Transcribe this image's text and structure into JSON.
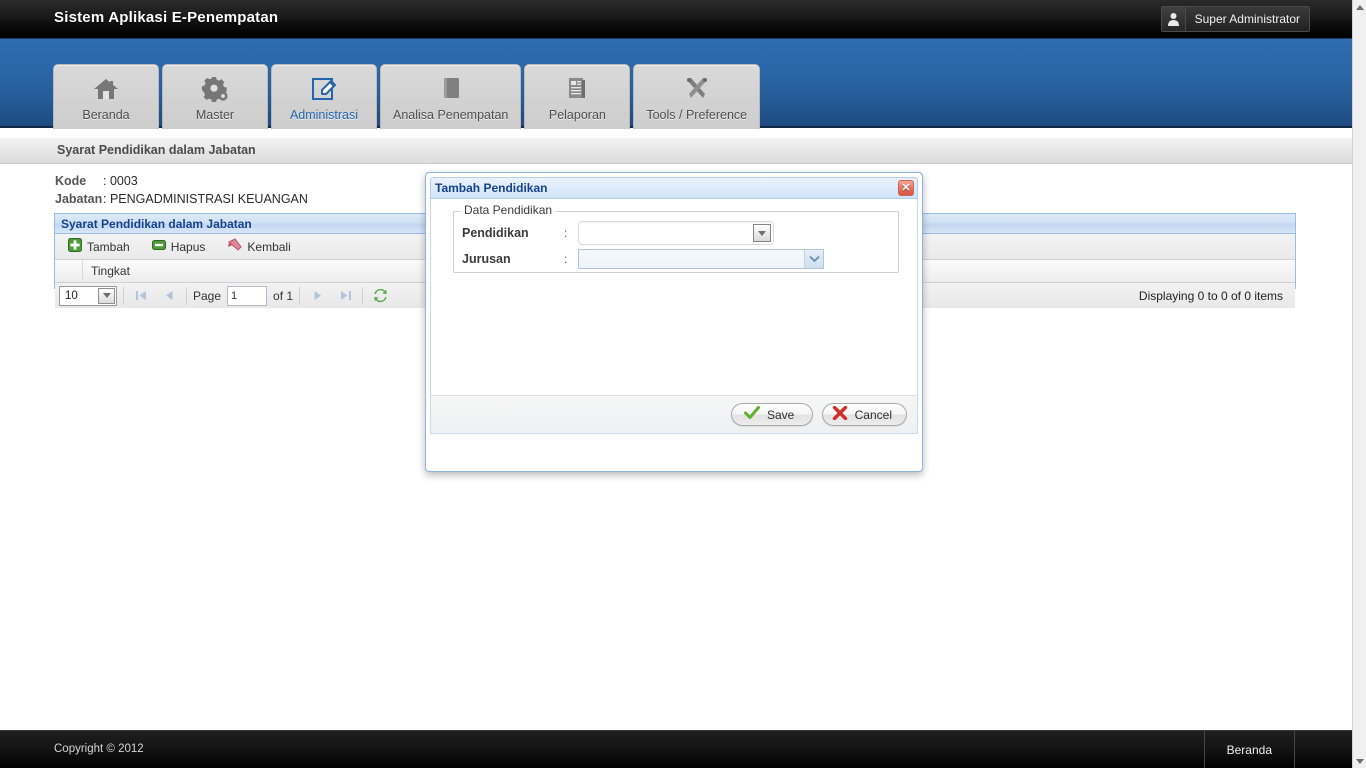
{
  "header": {
    "app_title": "Sistem Aplikasi E-Penempatan",
    "user_name": "Super Administrator",
    "user_icon": "user-icon"
  },
  "nav": {
    "tabs": [
      {
        "label": "Beranda",
        "icon": "home-icon",
        "active": false
      },
      {
        "label": "Master",
        "icon": "gear-icon",
        "active": false
      },
      {
        "label": "Administrasi",
        "icon": "edit-note-icon",
        "active": true
      },
      {
        "label": "Analisa Penempatan",
        "icon": "book-icon",
        "active": false
      },
      {
        "label": "Pelaporan",
        "icon": "report-icon",
        "active": false
      },
      {
        "label": "Tools / Preference",
        "icon": "tools-icon",
        "active": false
      }
    ]
  },
  "breadcrumb": {
    "title": "Syarat Pendidikan dalam Jabatan"
  },
  "main": {
    "kode_label": "Kode",
    "kode_colon": ": ",
    "kode_value": "0003",
    "jabatan_label": "Jabatan",
    "jabatan_colon": ": ",
    "jabatan_value": "PENGADMINISTRASI KEUANGAN",
    "grid": {
      "title": "Syarat Pendidikan dalam Jabatan",
      "toolbar": [
        {
          "label": "Tambah",
          "icon": "add-plus-icon"
        },
        {
          "label": "Hapus",
          "icon": "delete-minus-icon"
        },
        {
          "label": "Kembali",
          "icon": "back-arrow-icon"
        }
      ],
      "columns": [
        "Tingkat"
      ],
      "rows": [],
      "footer": {
        "page_size": "10",
        "page_label": "Page",
        "page_value": "1",
        "of_label": "of 1",
        "status": "Displaying 0 to 0 of 0 items",
        "first_icon": "first-page-icon",
        "prev_icon": "prev-page-icon",
        "next_icon": "next-page-icon",
        "last_icon": "last-page-icon",
        "refresh_icon": "refresh-icon"
      }
    }
  },
  "dialog": {
    "title": "Tambah Pendidikan",
    "close_icon": "close-icon",
    "legend": "Data Pendidikan",
    "fields": [
      {
        "label": "Pendidikan",
        "colon": ":",
        "value": "",
        "placeholder": ""
      },
      {
        "label": "Jurusan",
        "colon": ":",
        "value": "",
        "placeholder": ""
      }
    ],
    "save_label": "Save",
    "save_icon": "check-icon",
    "cancel_label": "Cancel",
    "cancel_icon": "cross-icon"
  },
  "footer": {
    "copyright": "Copyright © 2012",
    "link_label": "Beranda"
  },
  "colors": {
    "nav_blue_top": "#2d6cb0",
    "nav_blue_bottom": "#1d4a80",
    "active_tab_text": "#2565ad",
    "panel_border": "#99bbe8",
    "panel_title_text": "#15428b",
    "close_red": "#d9533f",
    "save_green": "#63b02f",
    "cancel_red": "#d22d2d"
  }
}
